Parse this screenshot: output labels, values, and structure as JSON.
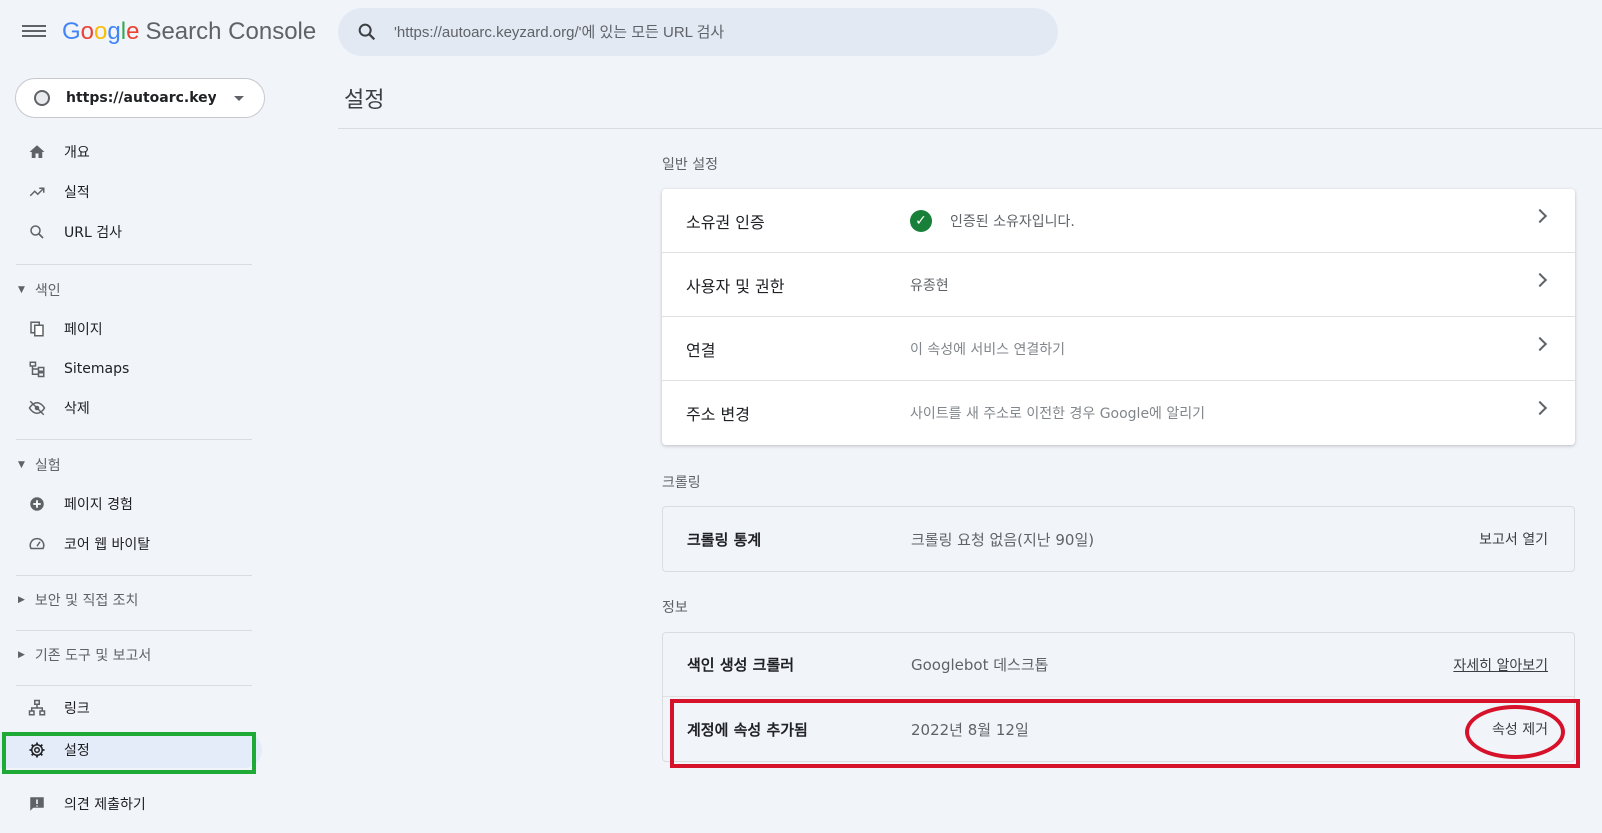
{
  "header": {
    "logo_letters": [
      "G",
      "o",
      "o",
      "g",
      "l",
      "e"
    ],
    "product": "Search Console",
    "search_placeholder": "'https://autoarc.keyzard.org/'에 있는 모든 URL 검사"
  },
  "property": {
    "url": "https://autoarc.keyz..."
  },
  "sidebar": {
    "items_top": [
      {
        "label": "개요",
        "icon": "home-icon"
      },
      {
        "label": "실적",
        "icon": "trending-up-icon"
      },
      {
        "label": "URL 검사",
        "icon": "search-icon"
      }
    ],
    "section_index": {
      "label": "색인",
      "expanded": true
    },
    "items_index": [
      {
        "label": "페이지",
        "icon": "pages-icon"
      },
      {
        "label": "Sitemaps",
        "icon": "sitemap-icon"
      },
      {
        "label": "삭제",
        "icon": "eye-off-icon"
      }
    ],
    "section_experiment": {
      "label": "실험",
      "expanded": true
    },
    "items_experiment": [
      {
        "label": "페이지 경험",
        "icon": "plus-circle-icon"
      },
      {
        "label": "코어 웹 바이탈",
        "icon": "speed-icon"
      }
    ],
    "section_security": {
      "label": "보안 및 직접 조치",
      "expanded": false
    },
    "section_legacy": {
      "label": "기존 도구 및 보고서",
      "expanded": false
    },
    "items_bottom": [
      {
        "label": "링크",
        "icon": "links-icon"
      },
      {
        "label": "설정",
        "icon": "gear-icon",
        "active": true
      },
      {
        "label": "의견 제출하기",
        "icon": "feedback-icon"
      }
    ]
  },
  "main": {
    "title": "설정",
    "general": {
      "title": "일반 설정",
      "rows": [
        {
          "label": "소유권 인증",
          "value": "인증된 소유자입니다."
        },
        {
          "label": "사용자 및 권한",
          "value": "유종현"
        },
        {
          "label": "연결",
          "value": "이 속성에 서비스 연결하기"
        },
        {
          "label": "주소 변경",
          "value": "사이트를 새 주소로 이전한 경우 Google에 알리기"
        }
      ]
    },
    "crawling": {
      "title": "크롤링",
      "rows": [
        {
          "label": "크롤링 통계",
          "value": "크롤링 요청 없음(지난 90일)",
          "action": "보고서 열기"
        }
      ]
    },
    "info": {
      "title": "정보",
      "rows": [
        {
          "label": "색인 생성 크롤러",
          "value": "Googlebot 데스크톱",
          "action": "자세히 알아보기"
        },
        {
          "label": "계정에 속성 추가됨",
          "value": "2022년 8월 12일",
          "action": "속성 제거"
        }
      ]
    }
  },
  "colors": {
    "accent_green": "#188038",
    "annotation_red": "#d6112a",
    "annotation_green": "#1fa936",
    "background": "#f1f4f9"
  }
}
